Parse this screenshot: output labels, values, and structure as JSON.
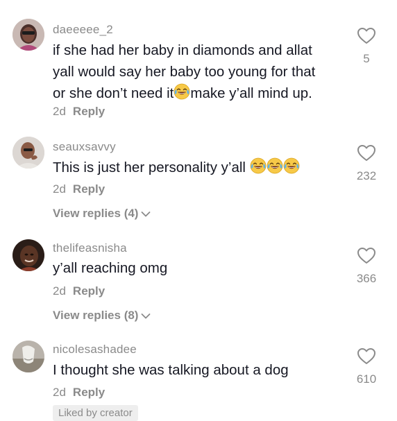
{
  "comments": [
    {
      "username": "daeeeee_2",
      "lines": [
        "if she had her baby in diamonds and allat",
        "yall would say her baby too young for that",
        "or she don’t need it",
        "make y’all mind up."
      ],
      "time": "2d",
      "reply_label": "Reply",
      "likes": "5"
    },
    {
      "username": "seauxsavvy",
      "text": "This is just her personality y’all",
      "time": "2d",
      "reply_label": "Reply",
      "view_replies": "View replies (4)",
      "likes": "232"
    },
    {
      "username": "thelifeasnisha",
      "text": "y’all reaching omg",
      "time": "2d",
      "reply_label": "Reply",
      "view_replies": "View replies (8)",
      "likes": "366"
    },
    {
      "username": "nicolesashadee",
      "text": "I thought she was talking about a dog",
      "time": "2d",
      "reply_label": "Reply",
      "badge": "Liked by creator",
      "likes": "610"
    }
  ],
  "icons": {
    "like": "heart-outline-icon",
    "expand": "chevron-down-icon",
    "emoji": "laughing-tears-emoji"
  },
  "colors": {
    "text": "#161823",
    "muted": "#8a8a8a",
    "background": "#ffffff"
  }
}
